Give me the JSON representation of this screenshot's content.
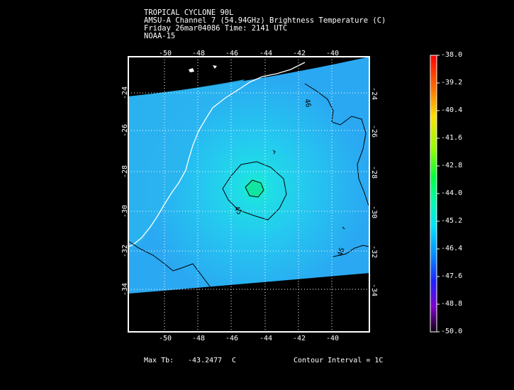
{
  "header": {
    "line1": "TROPICAL CYCLONE 90L",
    "line2": "AMSU-A Channel 7 (54.94GHz) Brightness Temperature (C)",
    "line3": "Friday 26mar04086 Time: 2141 UTC",
    "line4": "NOAA-15"
  },
  "axes": {
    "lon_ticks": [
      "-50",
      "-48",
      "-46",
      "-44",
      "-42",
      "-40"
    ],
    "lat_ticks": [
      "-24",
      "-26",
      "-28",
      "-30",
      "-32",
      "-34"
    ]
  },
  "contours": {
    "labels": [
      "45",
      "46",
      "46"
    ]
  },
  "colorbar": {
    "labels": [
      "-38.0",
      "-39.2",
      "-40.4",
      "-41.6",
      "-42.8",
      "-44.0",
      "-45.2",
      "-46.4",
      "-47.6",
      "-48.8",
      "-50.0"
    ],
    "min": -50.0,
    "max": -38.0
  },
  "footer": {
    "max_tb_label": "Max Tb:",
    "max_tb_value": "-43.2477",
    "max_tb_unit": "C",
    "contour_interval": "Contour Interval = 1C"
  }
}
